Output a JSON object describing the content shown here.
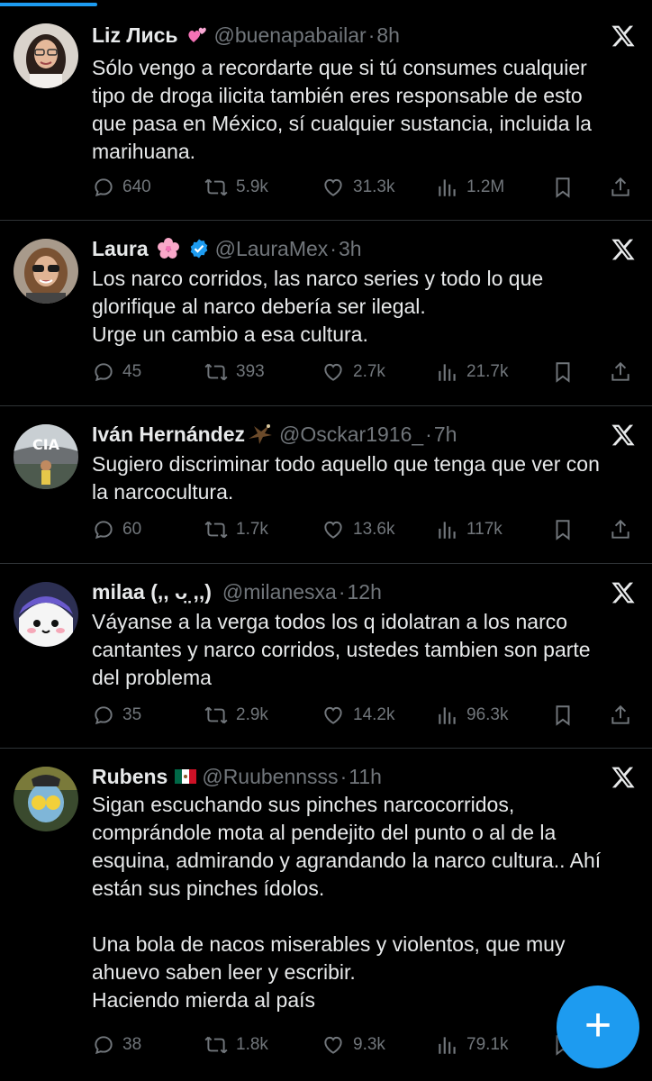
{
  "tweets": [
    {
      "name": "Liz Лись",
      "emoji": "pink-hearts",
      "handle": "@buenapabailar",
      "time": "8h",
      "verified": false,
      "text": "Sólo vengo a recordarte que si tú consumes cualquier\ntipo de droga ilicita también eres responsable de esto\nque pasa en México, sí cualquier sustancia, incluida la\nmarihuana.",
      "replies": "640",
      "reposts": "5.9k",
      "likes": "31.3k",
      "views": "1.2M"
    },
    {
      "name": "Laura",
      "emoji": "cherry-blossom",
      "handle": "@LauraMex",
      "time": "3h",
      "verified": true,
      "text": "Los narco corridos, las narco series y todo lo que\nglorifique al narco debería ser ilegal.\nUrge un cambio a esa cultura.",
      "replies": "45",
      "reposts": "393",
      "likes": "2.7k",
      "views": "21.7k"
    },
    {
      "name": "Iván Hernández",
      "emoji": "eagle",
      "handle": "@Osckar1916_",
      "time": "7h",
      "verified": false,
      "text": "Sugiero discriminar todo aquello que tenga que ver con\nla narcocultura.",
      "replies": "60",
      "reposts": "1.7k",
      "likes": "13.6k",
      "views": "117k"
    },
    {
      "name": "milaa (,, ᴗ̤ ,,)",
      "emoji": "",
      "handle": "@milanesxa",
      "time": "12h",
      "verified": false,
      "text": "Váyanse a la verga todos los q idolatran a los narco\ncantantes y narco corridos, ustedes tambien son parte\ndel problema",
      "replies": "35",
      "reposts": "2.9k",
      "likes": "14.2k",
      "views": "96.3k"
    },
    {
      "name": "Rubens",
      "emoji": "mexico-flag",
      "handle": "@Ruubennsss",
      "time": "11h",
      "verified": false,
      "text": "Sigan escuchando sus pinches narcocorridos,\ncomprándole mota al pendejito del punto o al de la\nesquina, admirando y agrandando la narco cultura.. Ahí\nestán sus pinches ídolos.\n\nUna bola de nacos miserables y violentos, que muy\nahuevo saben leer y escribir.\nHaciendo mierda al país",
      "replies": "38",
      "reposts": "1.8k",
      "likes": "9.3k",
      "views": "79.1k"
    }
  ],
  "fab": {
    "label": "+",
    "icon": "compose-plus-icon"
  },
  "colors": {
    "accent": "#1d9bf0",
    "muted": "#71767b",
    "text": "#e7e9ea",
    "divider": "#2f3336",
    "background": "#000000"
  }
}
